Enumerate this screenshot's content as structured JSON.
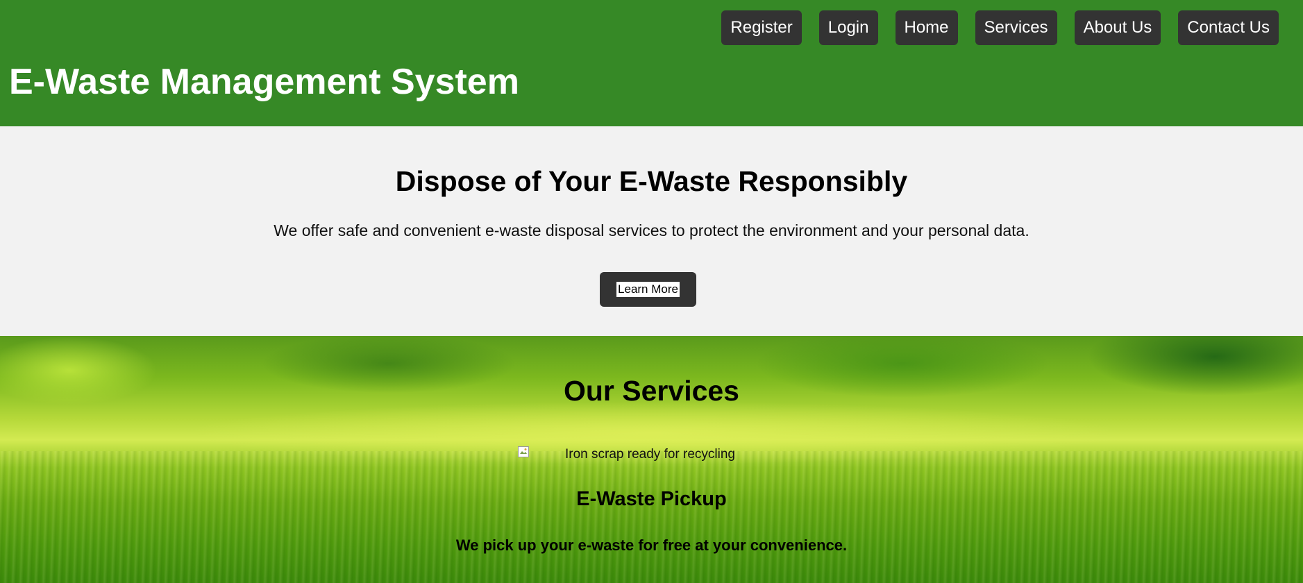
{
  "header": {
    "title": "E-Waste Management System",
    "background_color": "#368926",
    "nav": [
      {
        "label": "Register"
      },
      {
        "label": "Login"
      },
      {
        "label": "Home"
      },
      {
        "label": "Services"
      },
      {
        "label": "About Us"
      },
      {
        "label": "Contact Us"
      }
    ]
  },
  "hero": {
    "heading": "Dispose of Your E-Waste Responsibly",
    "description": "We offer safe and convenient e-waste disposal services to protect the environment and your personal data.",
    "button_label": "Learn More"
  },
  "services": {
    "heading": "Our Services",
    "items": [
      {
        "image_alt": "Iron scrap ready for recycling",
        "title": "E-Waste Pickup",
        "description": "We pick up your e-waste for free at your convenience."
      }
    ]
  },
  "colors": {
    "header_green": "#368926",
    "button_dark": "#333333",
    "hero_background": "#f2f2f2"
  }
}
